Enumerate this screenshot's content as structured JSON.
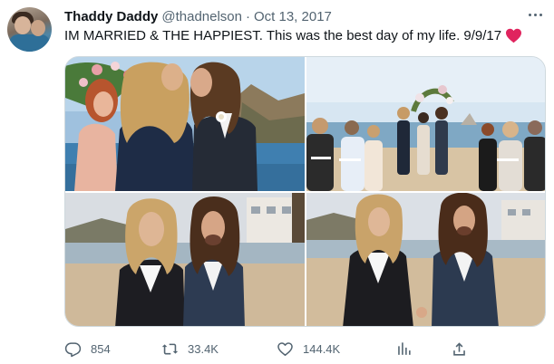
{
  "author": {
    "display_name": "Thaddy Daddy",
    "handle": "@thadnelson",
    "separator": "·",
    "date": "Oct 13, 2017"
  },
  "tweet": {
    "text": "IM MARRIED & THE HAPPIEST. This was the best day of my life. 9/9/17",
    "emoji": "heart-icon"
  },
  "media": {
    "count": 4
  },
  "actions": {
    "replies": "854",
    "retweets": "33.4K",
    "likes": "144.4K"
  },
  "icons": {
    "more": "more-dots-icon",
    "reply": "reply-icon",
    "retweet": "retweet-icon",
    "like": "like-icon",
    "views": "views-icon",
    "share": "share-icon"
  },
  "colors": {
    "text": "#0f1419",
    "secondary": "#536471",
    "heart": "#f91880",
    "border": "#cfd9de"
  }
}
